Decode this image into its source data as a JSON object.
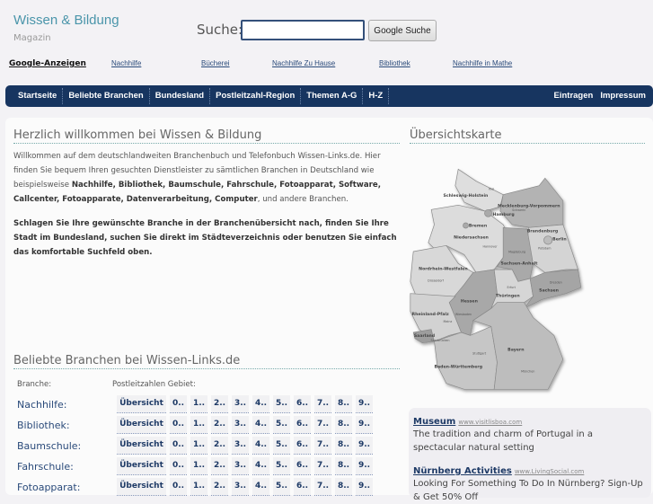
{
  "header": {
    "title": "Wissen & Bildung",
    "subtitle": "Magazin",
    "search_label": "Suche:",
    "search_value": "",
    "search_button": "Google Suche"
  },
  "ads_bar": {
    "label": "Google-Anzeigen",
    "links": [
      "Nachhilfe",
      "Bücherei",
      "Nachhilfe Zu Hause",
      "Bibliothek",
      "Nachhilfe in Mathe"
    ]
  },
  "nav": {
    "items": [
      "Startseite",
      "Beliebte Branchen",
      "Bundesland",
      "Postleitzahl-Region",
      "Themen A-G",
      "H-Z"
    ],
    "right": [
      "Eintragen",
      "Impressum"
    ]
  },
  "welcome": {
    "heading": "Herzlich willkommen bei Wissen & Bildung",
    "intro": "Willkommen auf dem deutschlandweiten Branchenbuch und Telefonbuch Wissen-Links.de. Hier finden Sie bequem Ihren gesuchten Dienstleister zu sämtlichen Branchen in Deutschland wie beispielsweise ",
    "bold_list": "Nachhilfe, Bibliothek, Baumschule, Fahrschule, Fotoapparat, Software, Callcenter, Fotoapparate, Datenverarbeitung, Computer",
    "outro": ", und andere Branchen.",
    "paragraph2": "Schlagen Sie Ihre gewünschte Branche in der Branchenübersicht nach, finden Sie Ihre Stadt im Bundesland, suchen Sie direkt im Städteverzeichnis oder benutzen Sie einfach das komfortable Suchfeld oben."
  },
  "popular": {
    "heading": "Beliebte Branchen bei Wissen-Links.de",
    "col_branch": "Branche:",
    "col_plz": "Postleitzahlen Gebiet:",
    "overview_label": "Übersicht",
    "plz": [
      "0..",
      "1..",
      "2..",
      "3..",
      "4..",
      "5..",
      "6..",
      "7..",
      "8..",
      "9.."
    ],
    "rows": [
      "Nachhilfe:",
      "Bibliothek:",
      "Baumschule:",
      "Fahrschule:",
      "Fotoapparat:"
    ]
  },
  "map": {
    "heading": "Übersichtskarte",
    "states": [
      "Schleswig-Holstein",
      "Mecklenburg-Vorpommern",
      "Hamburg",
      "Bremen",
      "Niedersachsen",
      "Brandenburg",
      "Berlin",
      "Sachsen-Anhalt",
      "Nordrhein-Westfalen",
      "Hessen",
      "Thüringen",
      "Sachsen",
      "Rheinland-Pfalz",
      "Saarland",
      "Bayern",
      "Baden-Württemberg"
    ],
    "cities": [
      "Kiel",
      "Schwerin",
      "Hannover",
      "Potsdam",
      "Magdeburg",
      "Düsseldorf",
      "Erfurt",
      "Dresden",
      "Wiesbaden",
      "Mainz",
      "Saarbrücken",
      "Stuttgart",
      "München"
    ]
  },
  "ads": [
    {
      "title": "Museum",
      "url": "www.visitlisboa.com",
      "text": "The tradition and charm of Portugal in a spectacular natural setting"
    },
    {
      "title": "Nürnberg Activities",
      "url": "www.LivingSocial.com",
      "text": "Looking For Something To Do In Nürnberg? Sign-Up & Get 50% Off"
    }
  ]
}
